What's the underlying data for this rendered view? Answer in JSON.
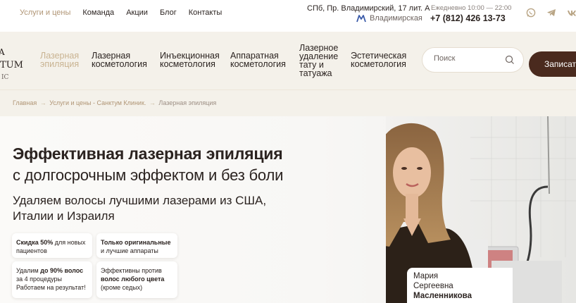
{
  "topbar": {
    "links": [
      {
        "label": "Услуги и цены",
        "active": true
      },
      {
        "label": "Команда"
      },
      {
        "label": "Акции"
      },
      {
        "label": "Блог"
      },
      {
        "label": "Контакты"
      }
    ],
    "address": "СПб, Пр. Владимирский, 17 лит. А",
    "metro": "Владимирская",
    "hours": "Ежедневно 10:00 — 22:00",
    "phone": "+7 (812) 426 13-73",
    "social_icons": [
      "whatsapp-icon",
      "telegram-icon",
      "vk-icon"
    ]
  },
  "logo": {
    "line1": "A",
    "line2": "TUM",
    "line3": "IC"
  },
  "mainnav": {
    "items": [
      {
        "line1": "Лазерная",
        "line2": "эпиляция",
        "active": true
      },
      {
        "line1": "Лазерная",
        "line2": "косметология"
      },
      {
        "line1": "Инъекционная",
        "line2": "косметология"
      },
      {
        "line1": "Аппаратная",
        "line2": "косметология"
      },
      {
        "line1": "Лазерное",
        "line2": "удаление",
        "line3": "тату и",
        "line4": "татуажа"
      },
      {
        "line1": "Эстетическая",
        "line2": "косметология"
      }
    ],
    "search_placeholder": "Поиск",
    "cta_label": "Записаться"
  },
  "breadcrumb": {
    "items": [
      "Главная",
      "Услуги и цены - Санктум Клиник.",
      "Лазерная эпиляция"
    ],
    "separator": "→"
  },
  "hero": {
    "title": "Эффективная лазерная эпиляция",
    "subtitle": "с долгосрочным эффектом и без боли",
    "lead": "Удаляем волосы лучшими лазерами из США, Италии и Израиля",
    "cards": [
      {
        "bold": "Скидка 50%",
        "text1": " для новых",
        "text2": "пациентов"
      },
      {
        "bold": "Только оригинальные",
        "text2": "и лучшие аппараты"
      },
      {
        "pre": "Удалим ",
        "bold": "до 90% волос",
        "text2": "за 4 процедуры",
        "text3": "Работаем на результат!"
      },
      {
        "pre": "Эффективны против",
        "bold": "волос любого цвета",
        "text3": "(кроме седых)"
      }
    ],
    "specialist": {
      "first_name": "Мария",
      "middle_name": "Сергеевна",
      "last_name": "Масленникова"
    }
  },
  "colors": {
    "accent": "#b09575",
    "dark": "#4a2a1e",
    "band": "#f4f1ea"
  }
}
